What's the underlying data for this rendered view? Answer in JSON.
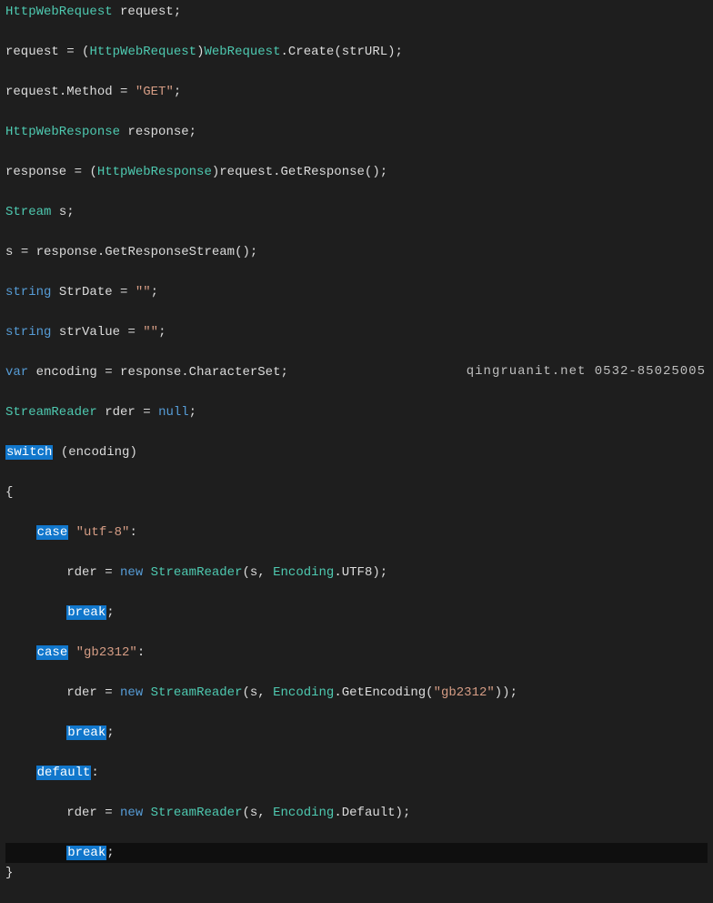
{
  "watermark": "qingruanit.net 0532-85025005",
  "lines": [
    {
      "tokens": [
        {
          "c": "type",
          "t": "HttpWebRequest"
        },
        {
          "c": "id",
          "t": " request"
        },
        {
          "c": "pun",
          "t": ";"
        }
      ]
    },
    {
      "tokens": [
        {
          "c": "id",
          "t": "request "
        },
        {
          "c": "pun",
          "t": "="
        },
        {
          "c": "id",
          "t": " "
        },
        {
          "c": "pun",
          "t": "("
        },
        {
          "c": "type",
          "t": "HttpWebRequest"
        },
        {
          "c": "pun",
          "t": ")"
        },
        {
          "c": "type",
          "t": "WebRequest"
        },
        {
          "c": "pun",
          "t": "."
        },
        {
          "c": "id",
          "t": "Create"
        },
        {
          "c": "pun",
          "t": "("
        },
        {
          "c": "id",
          "t": "strURL"
        },
        {
          "c": "pun",
          "t": ");"
        }
      ]
    },
    {
      "tokens": [
        {
          "c": "id",
          "t": "request"
        },
        {
          "c": "pun",
          "t": "."
        },
        {
          "c": "id",
          "t": "Method "
        },
        {
          "c": "pun",
          "t": "="
        },
        {
          "c": "id",
          "t": " "
        },
        {
          "c": "str",
          "t": "\"GET\""
        },
        {
          "c": "pun",
          "t": ";"
        }
      ]
    },
    {
      "tokens": [
        {
          "c": "type",
          "t": "HttpWebResponse"
        },
        {
          "c": "id",
          "t": " response"
        },
        {
          "c": "pun",
          "t": ";"
        }
      ]
    },
    {
      "tokens": [
        {
          "c": "id",
          "t": "response "
        },
        {
          "c": "pun",
          "t": "="
        },
        {
          "c": "id",
          "t": " "
        },
        {
          "c": "pun",
          "t": "("
        },
        {
          "c": "type",
          "t": "HttpWebResponse"
        },
        {
          "c": "pun",
          "t": ")"
        },
        {
          "c": "id",
          "t": "request"
        },
        {
          "c": "pun",
          "t": "."
        },
        {
          "c": "id",
          "t": "GetResponse"
        },
        {
          "c": "pun",
          "t": "();"
        }
      ]
    },
    {
      "tokens": [
        {
          "c": "type",
          "t": "Stream"
        },
        {
          "c": "id",
          "t": " s"
        },
        {
          "c": "pun",
          "t": ";"
        }
      ]
    },
    {
      "tokens": [
        {
          "c": "id",
          "t": "s "
        },
        {
          "c": "pun",
          "t": "="
        },
        {
          "c": "id",
          "t": " response"
        },
        {
          "c": "pun",
          "t": "."
        },
        {
          "c": "id",
          "t": "GetResponseStream"
        },
        {
          "c": "pun",
          "t": "();"
        }
      ]
    },
    {
      "tokens": [
        {
          "c": "kw",
          "t": "string"
        },
        {
          "c": "id",
          "t": " StrDate "
        },
        {
          "c": "pun",
          "t": "="
        },
        {
          "c": "id",
          "t": " "
        },
        {
          "c": "str",
          "t": "\"\""
        },
        {
          "c": "pun",
          "t": ";"
        }
      ]
    },
    {
      "tokens": [
        {
          "c": "kw",
          "t": "string"
        },
        {
          "c": "id",
          "t": " strValue "
        },
        {
          "c": "pun",
          "t": "="
        },
        {
          "c": "id",
          "t": " "
        },
        {
          "c": "str",
          "t": "\"\""
        },
        {
          "c": "pun",
          "t": ";"
        }
      ]
    },
    {
      "tokens": [
        {
          "c": "kw",
          "t": "var"
        },
        {
          "c": "id",
          "t": " encoding "
        },
        {
          "c": "pun",
          "t": "="
        },
        {
          "c": "id",
          "t": " response"
        },
        {
          "c": "pun",
          "t": "."
        },
        {
          "c": "id",
          "t": "CharacterSet"
        },
        {
          "c": "pun",
          "t": ";"
        }
      ]
    },
    {
      "tokens": [
        {
          "c": "type",
          "t": "StreamReader"
        },
        {
          "c": "id",
          "t": " rder "
        },
        {
          "c": "pun",
          "t": "="
        },
        {
          "c": "id",
          "t": " "
        },
        {
          "c": "kw",
          "t": "null"
        },
        {
          "c": "pun",
          "t": ";"
        }
      ]
    },
    {
      "tokens": [
        {
          "c": "kw-box",
          "t": "switch"
        },
        {
          "c": "id",
          "t": " "
        },
        {
          "c": "pun",
          "t": "("
        },
        {
          "c": "id",
          "t": "encoding"
        },
        {
          "c": "pun",
          "t": ")"
        }
      ]
    },
    {
      "tokens": [
        {
          "c": "pun",
          "t": "{"
        }
      ]
    },
    {
      "tokens": [
        {
          "c": "id",
          "t": "    "
        },
        {
          "c": "kw-box",
          "t": "case"
        },
        {
          "c": "id",
          "t": " "
        },
        {
          "c": "str",
          "t": "\"utf-8\""
        },
        {
          "c": "pun",
          "t": ":"
        }
      ]
    },
    {
      "tokens": [
        {
          "c": "id",
          "t": "        rder "
        },
        {
          "c": "pun",
          "t": "="
        },
        {
          "c": "id",
          "t": " "
        },
        {
          "c": "kw",
          "t": "new"
        },
        {
          "c": "id",
          "t": " "
        },
        {
          "c": "type",
          "t": "StreamReader"
        },
        {
          "c": "pun",
          "t": "("
        },
        {
          "c": "id",
          "t": "s"
        },
        {
          "c": "pun",
          "t": ","
        },
        {
          "c": "id",
          "t": " "
        },
        {
          "c": "type",
          "t": "Encoding"
        },
        {
          "c": "pun",
          "t": "."
        },
        {
          "c": "id",
          "t": "UTF8"
        },
        {
          "c": "pun",
          "t": ");"
        }
      ]
    },
    {
      "tokens": [
        {
          "c": "id",
          "t": "        "
        },
        {
          "c": "kw-box",
          "t": "break"
        },
        {
          "c": "pun",
          "t": ";"
        }
      ]
    },
    {
      "tokens": [
        {
          "c": "id",
          "t": "    "
        },
        {
          "c": "kw-box",
          "t": "case"
        },
        {
          "c": "id",
          "t": " "
        },
        {
          "c": "str",
          "t": "\"gb2312\""
        },
        {
          "c": "pun",
          "t": ":"
        }
      ]
    },
    {
      "tokens": [
        {
          "c": "id",
          "t": "        rder "
        },
        {
          "c": "pun",
          "t": "="
        },
        {
          "c": "id",
          "t": " "
        },
        {
          "c": "kw",
          "t": "new"
        },
        {
          "c": "id",
          "t": " "
        },
        {
          "c": "type",
          "t": "StreamReader"
        },
        {
          "c": "pun",
          "t": "("
        },
        {
          "c": "id",
          "t": "s"
        },
        {
          "c": "pun",
          "t": ","
        },
        {
          "c": "id",
          "t": " "
        },
        {
          "c": "type",
          "t": "Encoding"
        },
        {
          "c": "pun",
          "t": "."
        },
        {
          "c": "id",
          "t": "GetEncoding"
        },
        {
          "c": "pun",
          "t": "("
        },
        {
          "c": "str",
          "t": "\"gb2312\""
        },
        {
          "c": "pun",
          "t": "));"
        }
      ]
    },
    {
      "tokens": [
        {
          "c": "id",
          "t": "        "
        },
        {
          "c": "kw-box",
          "t": "break"
        },
        {
          "c": "pun",
          "t": ";"
        }
      ]
    },
    {
      "tokens": [
        {
          "c": "id",
          "t": "    "
        },
        {
          "c": "kw-box",
          "t": "default"
        },
        {
          "c": "pun",
          "t": ":"
        }
      ]
    },
    {
      "tokens": [
        {
          "c": "id",
          "t": "        rder "
        },
        {
          "c": "pun",
          "t": "="
        },
        {
          "c": "id",
          "t": " "
        },
        {
          "c": "kw",
          "t": "new"
        },
        {
          "c": "id",
          "t": " "
        },
        {
          "c": "type",
          "t": "StreamReader"
        },
        {
          "c": "pun",
          "t": "("
        },
        {
          "c": "id",
          "t": "s"
        },
        {
          "c": "pun",
          "t": ","
        },
        {
          "c": "id",
          "t": " "
        },
        {
          "c": "type",
          "t": "Encoding"
        },
        {
          "c": "pun",
          "t": "."
        },
        {
          "c": "id",
          "t": "Default"
        },
        {
          "c": "pun",
          "t": ");"
        }
      ]
    },
    {
      "hl": true,
      "tokens": [
        {
          "c": "id",
          "t": "        "
        },
        {
          "c": "kw-box",
          "t": "break"
        },
        {
          "c": "pun",
          "t": ";"
        }
      ]
    },
    {
      "tokens": [
        {
          "c": "pun",
          "t": "}"
        }
      ]
    }
  ]
}
